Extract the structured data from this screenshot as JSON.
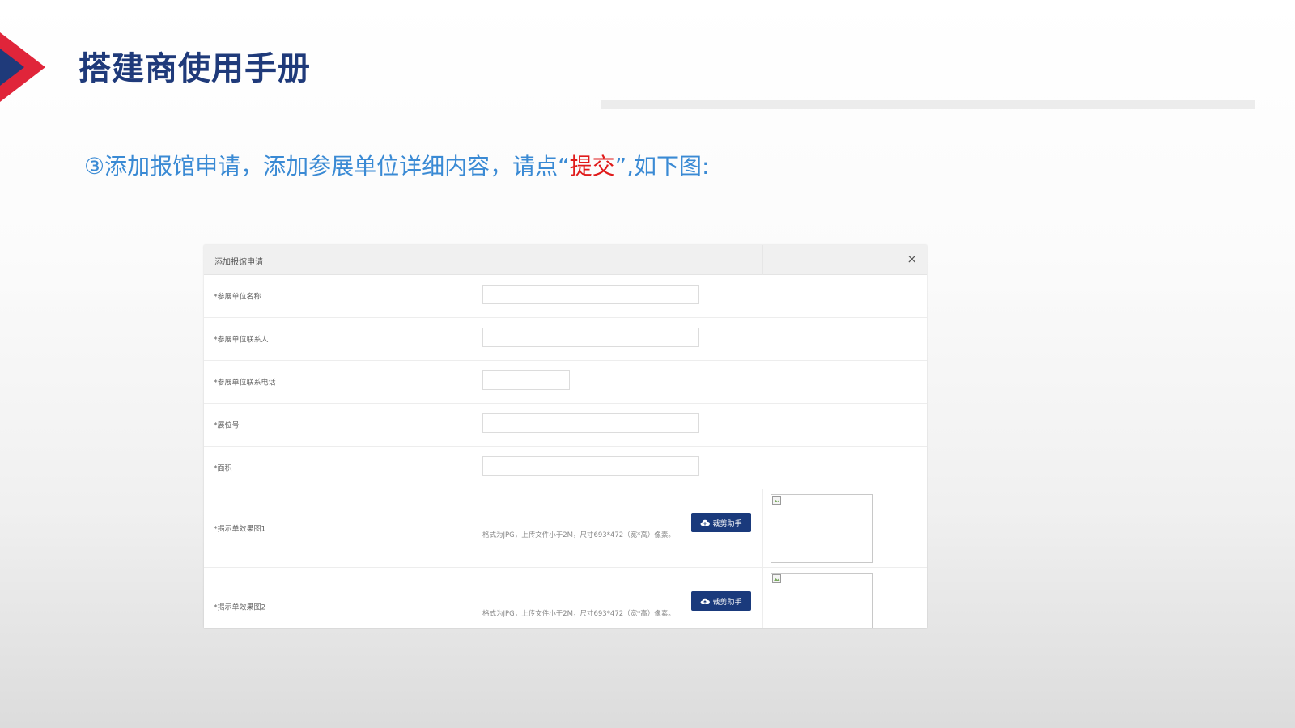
{
  "header": {
    "title": "搭建商使用手册"
  },
  "instruction": {
    "prefix": "③添加报馆申请，添加参展单位详细内容，请点“",
    "highlight": "提交",
    "suffix": "”,如下图:"
  },
  "dialog": {
    "title": "添加报馆申请",
    "close_icon": "×",
    "fields": [
      {
        "label": "*参展单位名称",
        "value": ""
      },
      {
        "label": "*参展单位联系人",
        "value": ""
      },
      {
        "label": "*参展单位联系电话",
        "value": ""
      },
      {
        "label": "*展位号",
        "value": ""
      },
      {
        "label": "*面积",
        "value": ""
      }
    ],
    "uploads": [
      {
        "label": "*揭示单效果图1",
        "hint": "格式为JPG，上传文件小于2M，尺寸693*472（宽*高）像素。",
        "button_label": "裁剪助手",
        "icon": "cloud-upload-icon"
      },
      {
        "label": "*揭示单效果图2",
        "hint": "格式为JPG，上传文件小于2M，尺寸693*472（宽*高）像素。",
        "button_label": "裁剪助手",
        "icon": "cloud-upload-icon"
      }
    ]
  },
  "colors": {
    "title": "#1f3a7a",
    "instruction": "#3a8ad4",
    "highlight": "#e01b1b",
    "button": "#1a3a7c",
    "logo_red": "#e0253a",
    "logo_blue": "#1f3a7a"
  }
}
